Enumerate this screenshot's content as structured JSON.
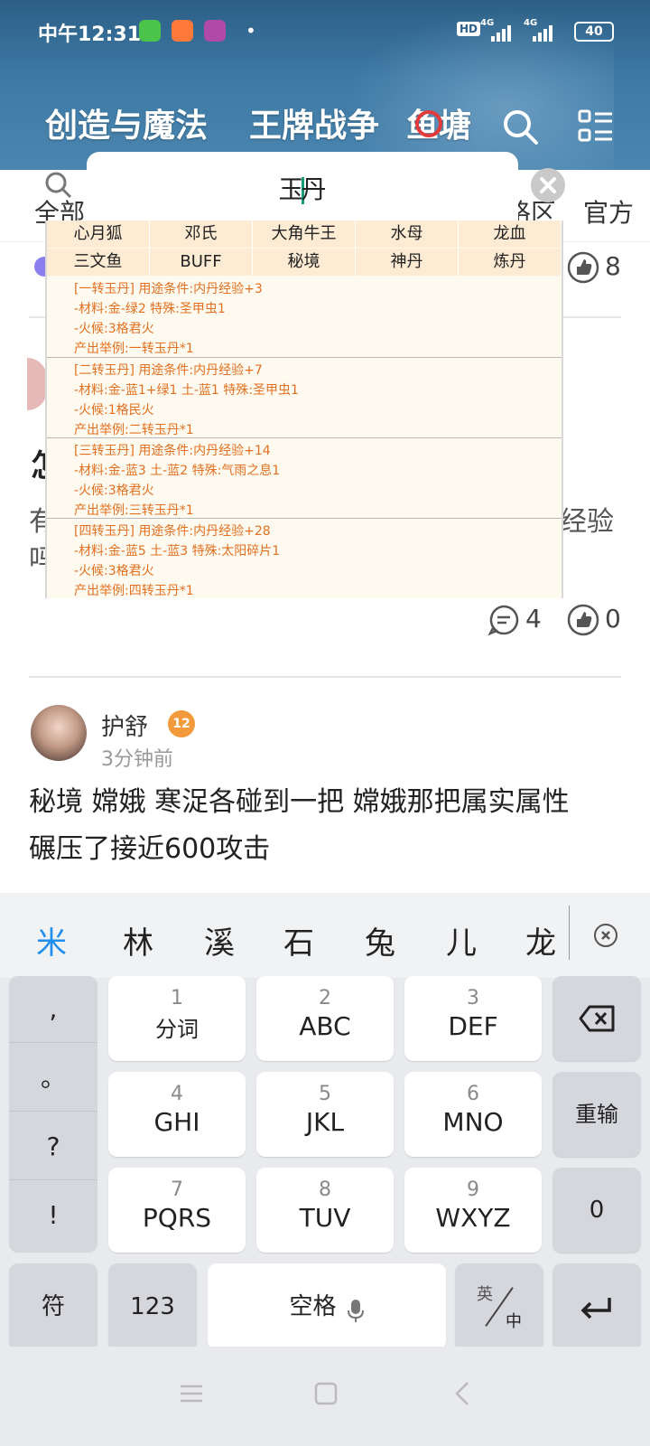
{
  "status_bar": {
    "time": "中午12:31",
    "dot": "•",
    "hd_label": "HD",
    "network_1": "4G",
    "network_2": "4G",
    "battery": "40"
  },
  "header": {
    "tabs": [
      "创造与魔法",
      "王牌战争",
      "鱼塘"
    ],
    "badge_color": "#e23b3b"
  },
  "subnav": {
    "items": [
      "全部",
      "格区",
      "官方"
    ]
  },
  "search": {
    "query_before_caret": "玉",
    "query_after_caret": "丹"
  },
  "tags_row_1": [
    "心月狐",
    "邓氏",
    "大角牛王",
    "水母",
    "龙血"
  ],
  "tags_row_2": [
    "三文鱼",
    "BUFF",
    "秘境",
    "神丹",
    "炼丹"
  ],
  "entries": [
    {
      "line1": "[一转玉丹] 用途条件:内丹经验+3",
      "line2": "-材料:金-绿2 特殊:圣甲虫1",
      "line3": "-火候:3格君火",
      "line4": "产出举例:一转玉丹*1"
    },
    {
      "line1": "[二转玉丹] 用途条件:内丹经验+7",
      "line2": "-材料:金-蓝1+绿1 土-蓝1 特殊:圣甲虫1",
      "line3": "-火候:1格民火",
      "line4": "产出举例:二转玉丹*1"
    },
    {
      "line1": "[三转玉丹] 用途条件:内丹经验+14",
      "line2": "-材料:金-蓝3 土-蓝2 特殊:气雨之息1",
      "line3": "-火候:3格君火",
      "line4": "产出举例:三转玉丹*1"
    },
    {
      "line1": "[四转玉丹] 用途条件:内丹经验+28",
      "line2": "-材料:金-蓝5 土-蓝3 特殊:太阳碎片1",
      "line3": "-火候:3格君火",
      "line4": "产出举例:四转玉丹*1"
    }
  ],
  "feed": {
    "post1_like_count": "8",
    "post2_partial_title": "怎",
    "post2_partial_line1_left": "有",
    "post2_partial_line1_right": "经验",
    "post2_partial_line2_left": "吗",
    "post2_comment_count": "4",
    "post2_like_count": "0",
    "post3": {
      "username": "护舒",
      "level": "12",
      "time": "3分钟前",
      "text_line1": "秘境 嫦娥 寒浞各碰到一把 嫦娥那把属实属性",
      "text_line2": "碾压了接近600攻击"
    }
  },
  "keyboard": {
    "candidates": [
      "米",
      "林",
      "溪",
      "石",
      "兔",
      "儿",
      "龙"
    ],
    "punctuation": [
      ",",
      "。",
      "?",
      "!"
    ],
    "keys": [
      {
        "num": "1",
        "label": "分词"
      },
      {
        "num": "2",
        "label": "ABC"
      },
      {
        "num": "3",
        "label": "DEF"
      },
      {
        "num": "4",
        "label": "GHI"
      },
      {
        "num": "5",
        "label": "JKL"
      },
      {
        "num": "6",
        "label": "MNO"
      },
      {
        "num": "7",
        "label": "PQRS"
      },
      {
        "num": "8",
        "label": "TUV"
      },
      {
        "num": "9",
        "label": "WXYZ"
      }
    ],
    "reenter": "重输",
    "zero": "0",
    "symbols": "符",
    "numbers": "123",
    "space": "空格",
    "lang_top": "英",
    "lang_bottom": "中"
  }
}
